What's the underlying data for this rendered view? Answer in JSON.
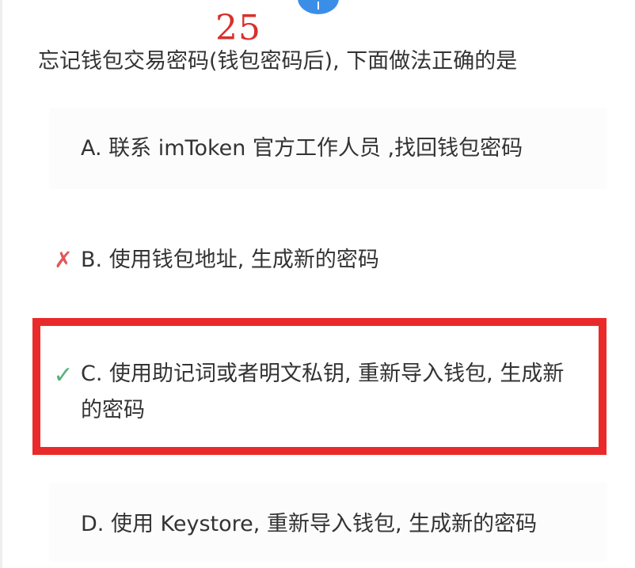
{
  "question": {
    "number": "25",
    "text": "忘记钱包交易密码(钱包密码后), 下面做法正确的是"
  },
  "options": [
    {
      "label": "A. 联系 imToken 官方工作人员 ,找回钱包密码",
      "mark": "",
      "mark_icon": "none"
    },
    {
      "label": "B. 使用钱包地址, 生成新的密码",
      "mark": "✗",
      "mark_icon": "cross-icon",
      "mark_color": "#e0585a"
    },
    {
      "label": "C. 使用助记词或者明文私钥, 重新导入钱包, 生成新的密码",
      "mark": "✓",
      "mark_icon": "check-icon",
      "mark_color": "#55b27c"
    },
    {
      "label": "D. 使用 Keystore, 重新导入钱包, 生成新的密码",
      "mark": "",
      "mark_icon": "none"
    }
  ],
  "colors": {
    "number": "#d9302c",
    "highlight": "#ea2a2a",
    "top_button": "#3b8ee8"
  }
}
